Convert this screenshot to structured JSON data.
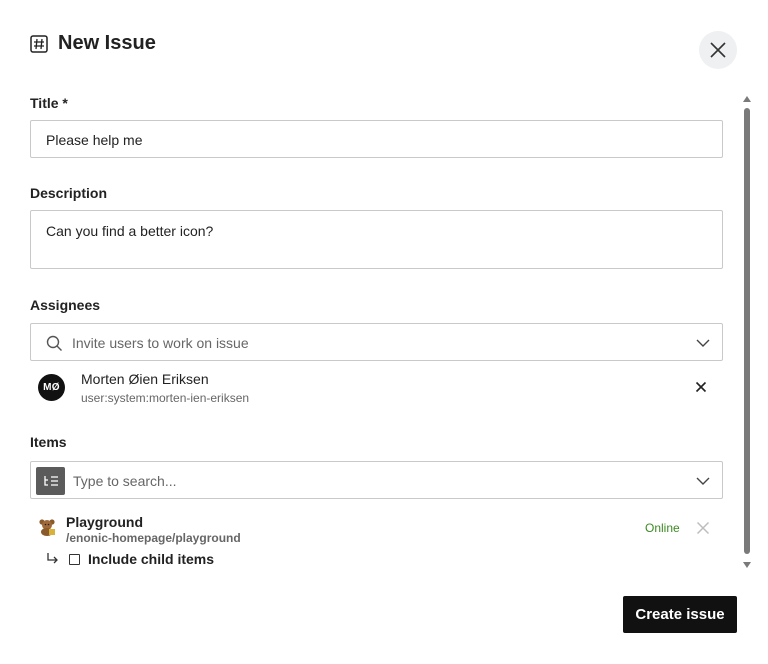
{
  "dialog": {
    "title": "New Issue",
    "title_icon": "hash-icon"
  },
  "form": {
    "title_label": "Title *",
    "title_value": "Please help me",
    "description_label": "Description",
    "description_value": "Can you find a better icon?",
    "assignees_label": "Assignees",
    "assignees_placeholder": "Invite users to work on issue",
    "items_label": "Items",
    "items_placeholder": "Type to search..."
  },
  "assignees": [
    {
      "initials": "MØ",
      "name": "Morten Øien Eriksen",
      "key": "user:system:morten-ien-eriksen"
    }
  ],
  "items": [
    {
      "name": "Playground",
      "path": "/enonic-homepage/playground",
      "status": "Online",
      "include_children_label": "Include child items",
      "include_children": false
    }
  ],
  "actions": {
    "create_label": "Create issue"
  },
  "colors": {
    "primary": "#111111",
    "online": "#3b8a22",
    "border": "#c9c9c9"
  }
}
